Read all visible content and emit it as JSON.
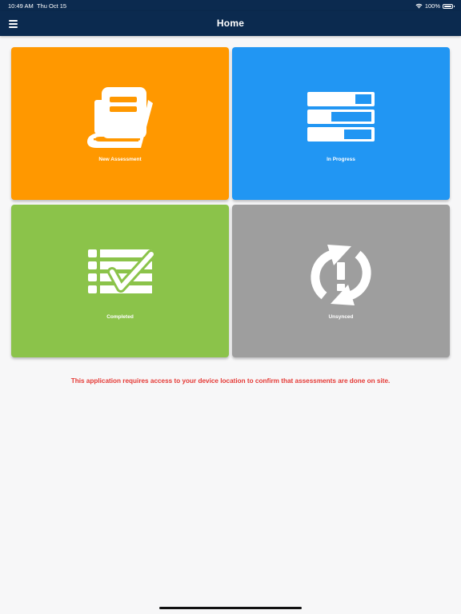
{
  "status_bar": {
    "time": "10:49 AM",
    "date": "Thu Oct 15",
    "battery": "100%"
  },
  "header": {
    "title": "Home",
    "menu_icon": "hamburger-menu-icon"
  },
  "tiles": [
    {
      "label": "New Assessment",
      "color": "#ff9800",
      "icon": "book-icon"
    },
    {
      "label": "In Progress",
      "color": "#2196f3",
      "icon": "progress-bars-icon"
    },
    {
      "label": "Completed",
      "color": "#8bc34a",
      "icon": "checklist-icon"
    },
    {
      "label": "Unsynced",
      "color": "#9e9e9e",
      "icon": "sync-alert-icon"
    }
  ],
  "notice": {
    "text": "This application requires access to your device location to confirm that assessments are done on site.",
    "color": "#e53935"
  },
  "theme": {
    "header_bg": "#0b2a4f",
    "page_bg": "#f7f7f8"
  }
}
